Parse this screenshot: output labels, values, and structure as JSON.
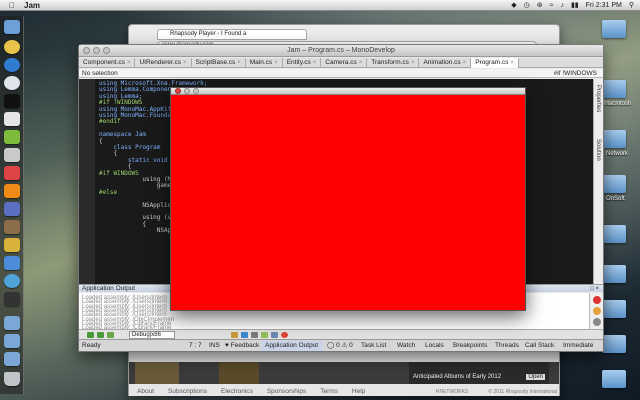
{
  "menubar": {
    "app_name": "Jam",
    "clock": "Fri 2:31 PM"
  },
  "browser": {
    "tab_title": "Rhapsody Player - I Found a",
    "address": "www.rhapsody.com",
    "promo": "Anticipated Albums of Early 2012",
    "promo_open": "Open",
    "footer_links": [
      "About",
      "Subscriptions",
      "Electronics",
      "Sponsorships",
      "Terms",
      "Help"
    ],
    "networks": "RNETWORKS",
    "copyright": "© 2011 Rhapsody International"
  },
  "monodevelop": {
    "window_title": "Jam – Program.cs – MonoDevelop",
    "tabs": [
      "Component.cs",
      "UIRenderer.cs",
      "ScriptBase.cs",
      "Main.cs",
      "Entity.cs",
      "Camera.cs",
      "Transform.cs",
      "Animation.cs",
      "Program.cs"
    ],
    "selection": "No selection",
    "define": "#if !WINDOWS",
    "right_pads": [
      "Properties",
      "Solution"
    ],
    "code": [
      {
        "text": "using Microsoft.Xna.Framework;",
        "cls": "kw"
      },
      {
        "text": "using Lemma.Components",
        "cls": "kw"
      },
      {
        "text": "using Lemma;",
        "cls": "kw"
      },
      {
        "text": "#if !WINDOWS",
        "cls": "pp"
      },
      {
        "text": "using MonoMac.AppKit;",
        "cls": "kw"
      },
      {
        "text": "using MonoMac.Foundati",
        "cls": "kw"
      },
      {
        "text": "#endif",
        "cls": "pp"
      },
      {
        "text": "",
        "cls": ""
      },
      {
        "text": "namespace Jam",
        "cls": "kw"
      },
      {
        "text": "{",
        "cls": ""
      },
      {
        "text": "    class Program",
        "cls": "kw"
      },
      {
        "text": "    {",
        "cls": ""
      },
      {
        "text": "        static void Ma",
        "cls": "kw"
      },
      {
        "text": "        {",
        "cls": ""
      },
      {
        "text": "#if WINDOWS",
        "cls": "pp"
      },
      {
        "text": "            using (Mc",
        "cls": ""
      },
      {
        "text": "                game.Ru",
        "cls": ""
      },
      {
        "text": "#else",
        "cls": "pp"
      },
      {
        "text": "",
        "cls": ""
      },
      {
        "text": "            NSApplicat",
        "cls": ""
      },
      {
        "text": "",
        "cls": ""
      },
      {
        "text": "            using (vor",
        "cls": ""
      },
      {
        "text": "            {",
        "cls": ""
      },
      {
        "text": "                NSAppl",
        "cls": ""
      }
    ],
    "output_title": "Application Output",
    "output_lines": [
      "Loaded assembly: /Users/Intern",
      "Loaded assembly: /Users/Intern",
      "Loaded assembly: /Users/Intern",
      "Loaded assembly: /Users/Intern",
      "Loaded assembly: /Users/Intern",
      "Loaded assembly: /ObjCImplemen",
      "Loaded assembly: /Library/Frame",
      "Loaded assembly: /Library/Frame"
    ],
    "debug_config": "Debug|x86",
    "status": {
      "ready": "Ready",
      "position": "7 : 7",
      "mode": "INS",
      "feedback": "Feedback",
      "app_output": "Application Output",
      "errors": "0",
      "warnings": "0",
      "task_list": "Task List",
      "watch": "Watch",
      "locals": "Locals",
      "breakpoints": "Breakpoints",
      "threads": "Threads",
      "call_stack": "Call Stack",
      "immediate": "Immediate"
    }
  },
  "game_window": {
    "fill_color": "#ff0000"
  },
  "desktop": {
    "labels": [
      "Macintosh",
      "Network",
      "OnSoft"
    ]
  }
}
